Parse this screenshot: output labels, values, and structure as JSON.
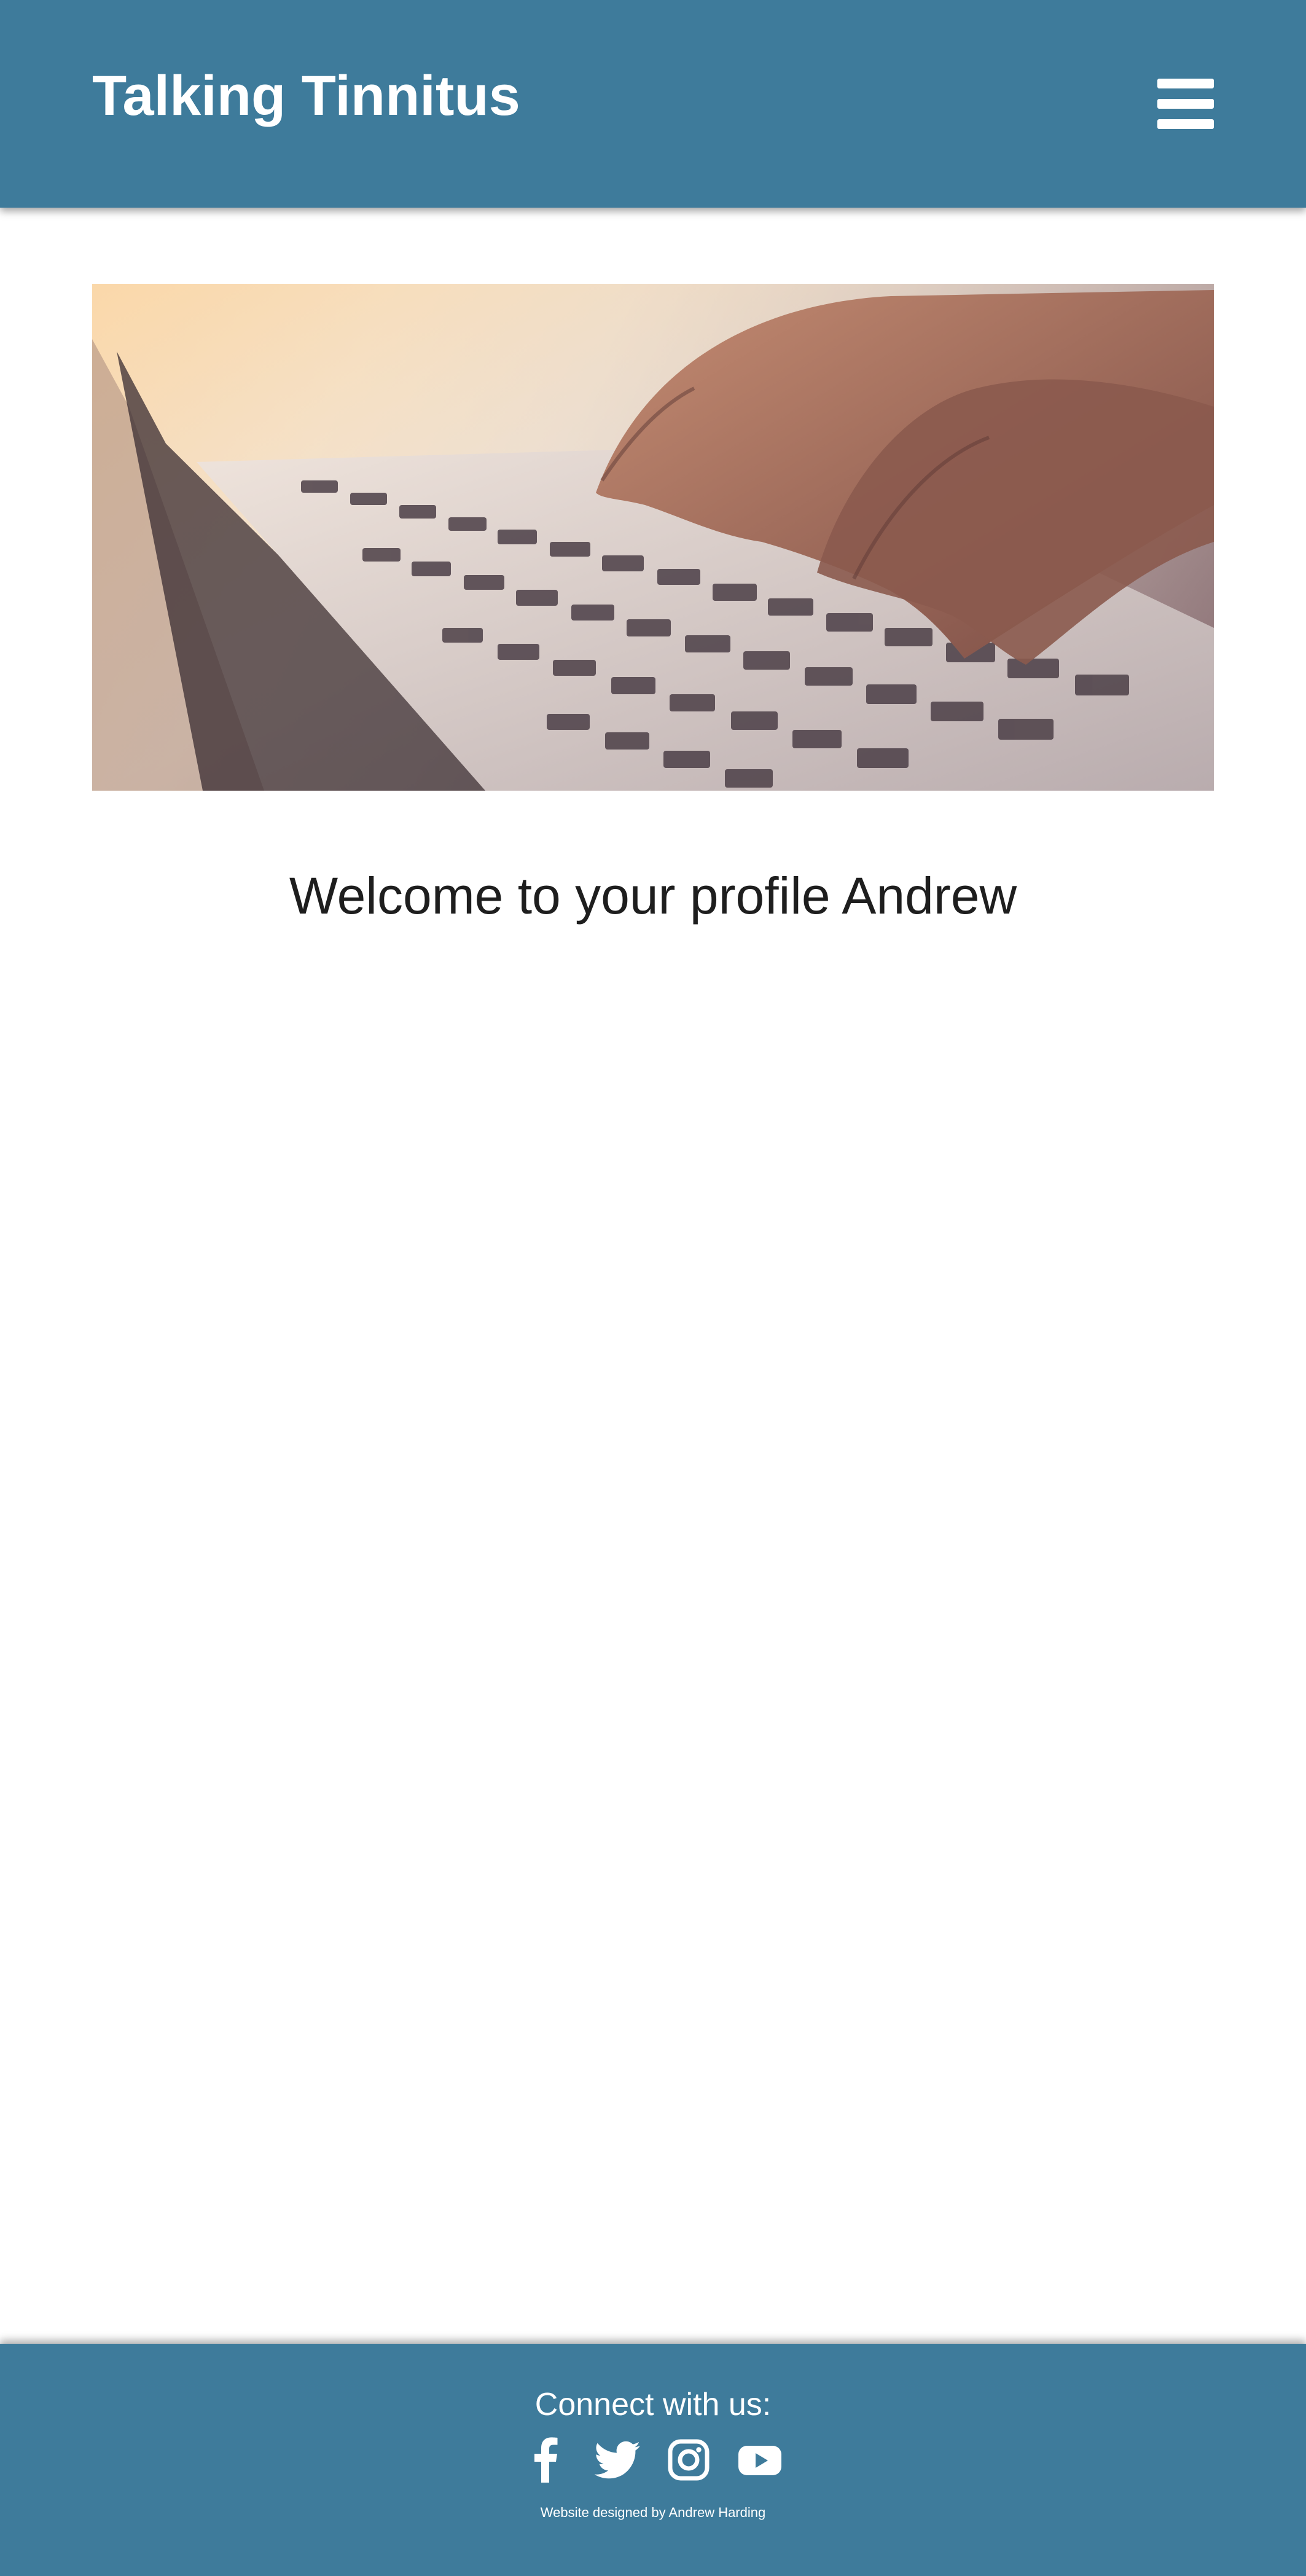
{
  "header": {
    "title": "Talking Tinnitus",
    "menu_icon": "hamburger-menu-icon"
  },
  "hero": {
    "image_icon": "hands-typing-on-laptop-image"
  },
  "main": {
    "welcome_text": "Welcome to your profile Andrew"
  },
  "footer": {
    "connect_label": "Connect with us:",
    "social_icons": [
      "facebook-icon",
      "twitter-icon",
      "instagram-icon",
      "youtube-icon"
    ],
    "credit": "Website designed by Andrew Harding"
  },
  "colors": {
    "brand": "#3e7b9b",
    "text": "#1e1e1e",
    "background": "#ffffff"
  }
}
